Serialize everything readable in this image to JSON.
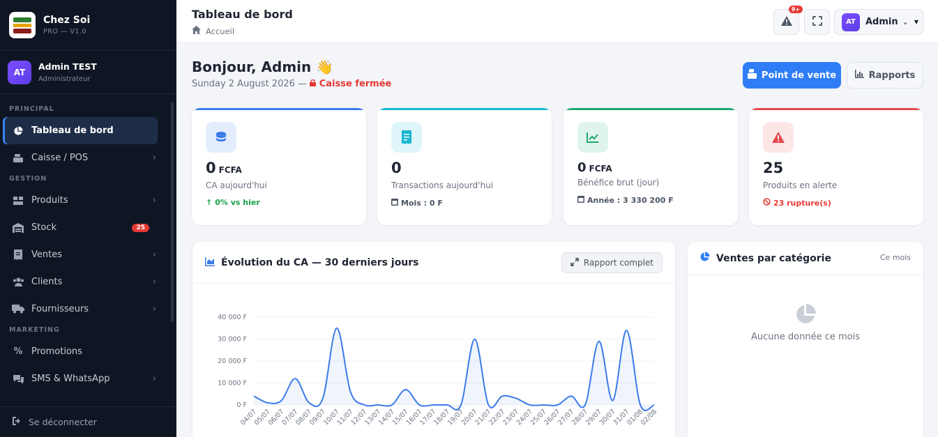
{
  "brand": {
    "name": "Chez Soi",
    "version": "PRO — V1.0"
  },
  "user": {
    "initials": "AT",
    "name": "Admin TEST",
    "role": "Administrateur"
  },
  "nav": {
    "sections": {
      "principal": "PRINCIPAL",
      "gestion": "GESTION",
      "marketing": "MARKETING"
    },
    "items": {
      "dashboard": "Tableau de bord",
      "pos": "Caisse / POS",
      "products": "Produits",
      "stock": "Stock",
      "stock_badge": "25",
      "sales": "Ventes",
      "clients": "Clients",
      "suppliers": "Fournisseurs",
      "promotions": "Promotions",
      "sms": "SMS & WhatsApp"
    },
    "logout": "Se déconnecter"
  },
  "topbar": {
    "title": "Tableau de bord",
    "breadcrumb": "Accueil",
    "notif_badge": "9+",
    "admin_initials": "AT",
    "admin_label": "Admin"
  },
  "greeting": {
    "hello": "Bonjour, Admin 👋",
    "date": "Sunday 2 August 2026 —",
    "status": "Caisse fermée",
    "pos_button": "Point de vente",
    "reports_button": "Rapports"
  },
  "stats": [
    {
      "value": "0",
      "unit": "FCFA",
      "label": "CA aujourd'hui",
      "sub": "0% vs hier",
      "color": "#3b7be8",
      "sub_color": "#16a34a"
    },
    {
      "value": "0",
      "unit": "",
      "label": "Transactions aujourd'hui",
      "sub": "Mois : 0 F",
      "color": "#17b6cf",
      "sub_color": "#4b5563"
    },
    {
      "value": "0",
      "unit": "FCFA",
      "label": "Bénéfice brut (jour)",
      "sub": "Année : 3 330 200 F",
      "color": "#1ea672",
      "sub_color": "#4b5563"
    },
    {
      "value": "25",
      "unit": "",
      "label": "Produits en alerte",
      "sub": "23 rupture(s)",
      "color": "#e5484d",
      "sub_color": "#e53935"
    }
  ],
  "chart_panel": {
    "title": "Évolution du CA — 30 derniers jours",
    "button": "Rapport complet"
  },
  "category_panel": {
    "title": "Ventes par catégorie",
    "period": "Ce mois",
    "empty": "Aucune donnée ce mois"
  },
  "chart_data": {
    "type": "area",
    "title": "Évolution du CA — 30 derniers jours",
    "x": [
      "04/07",
      "05/07",
      "06/07",
      "07/07",
      "08/07",
      "09/07",
      "10/07",
      "11/07",
      "12/07",
      "13/07",
      "14/07",
      "15/07",
      "16/07",
      "17/07",
      "18/07",
      "19/07",
      "20/07",
      "21/07",
      "22/07",
      "23/07",
      "24/07",
      "25/07",
      "26/07",
      "27/07",
      "28/07",
      "29/07",
      "30/07",
      "31/07",
      "01/08",
      "02/08"
    ],
    "series": [
      {
        "values": [
          4000,
          1000,
          2000,
          12000,
          1000,
          3000,
          35000,
          6000,
          0,
          0,
          0,
          7000,
          0,
          0,
          0,
          0,
          30000,
          0,
          4000,
          3000,
          0,
          0,
          0,
          4000,
          0,
          29000,
          2000,
          34000,
          0,
          0
        ]
      }
    ],
    "ylim": [
      0,
      40000
    ],
    "yticks": [
      "40 000 F",
      "30 000 F",
      "20 000 F",
      "10 000 F",
      "0 F"
    ],
    "color": "#3b7be8",
    "grid": true
  }
}
